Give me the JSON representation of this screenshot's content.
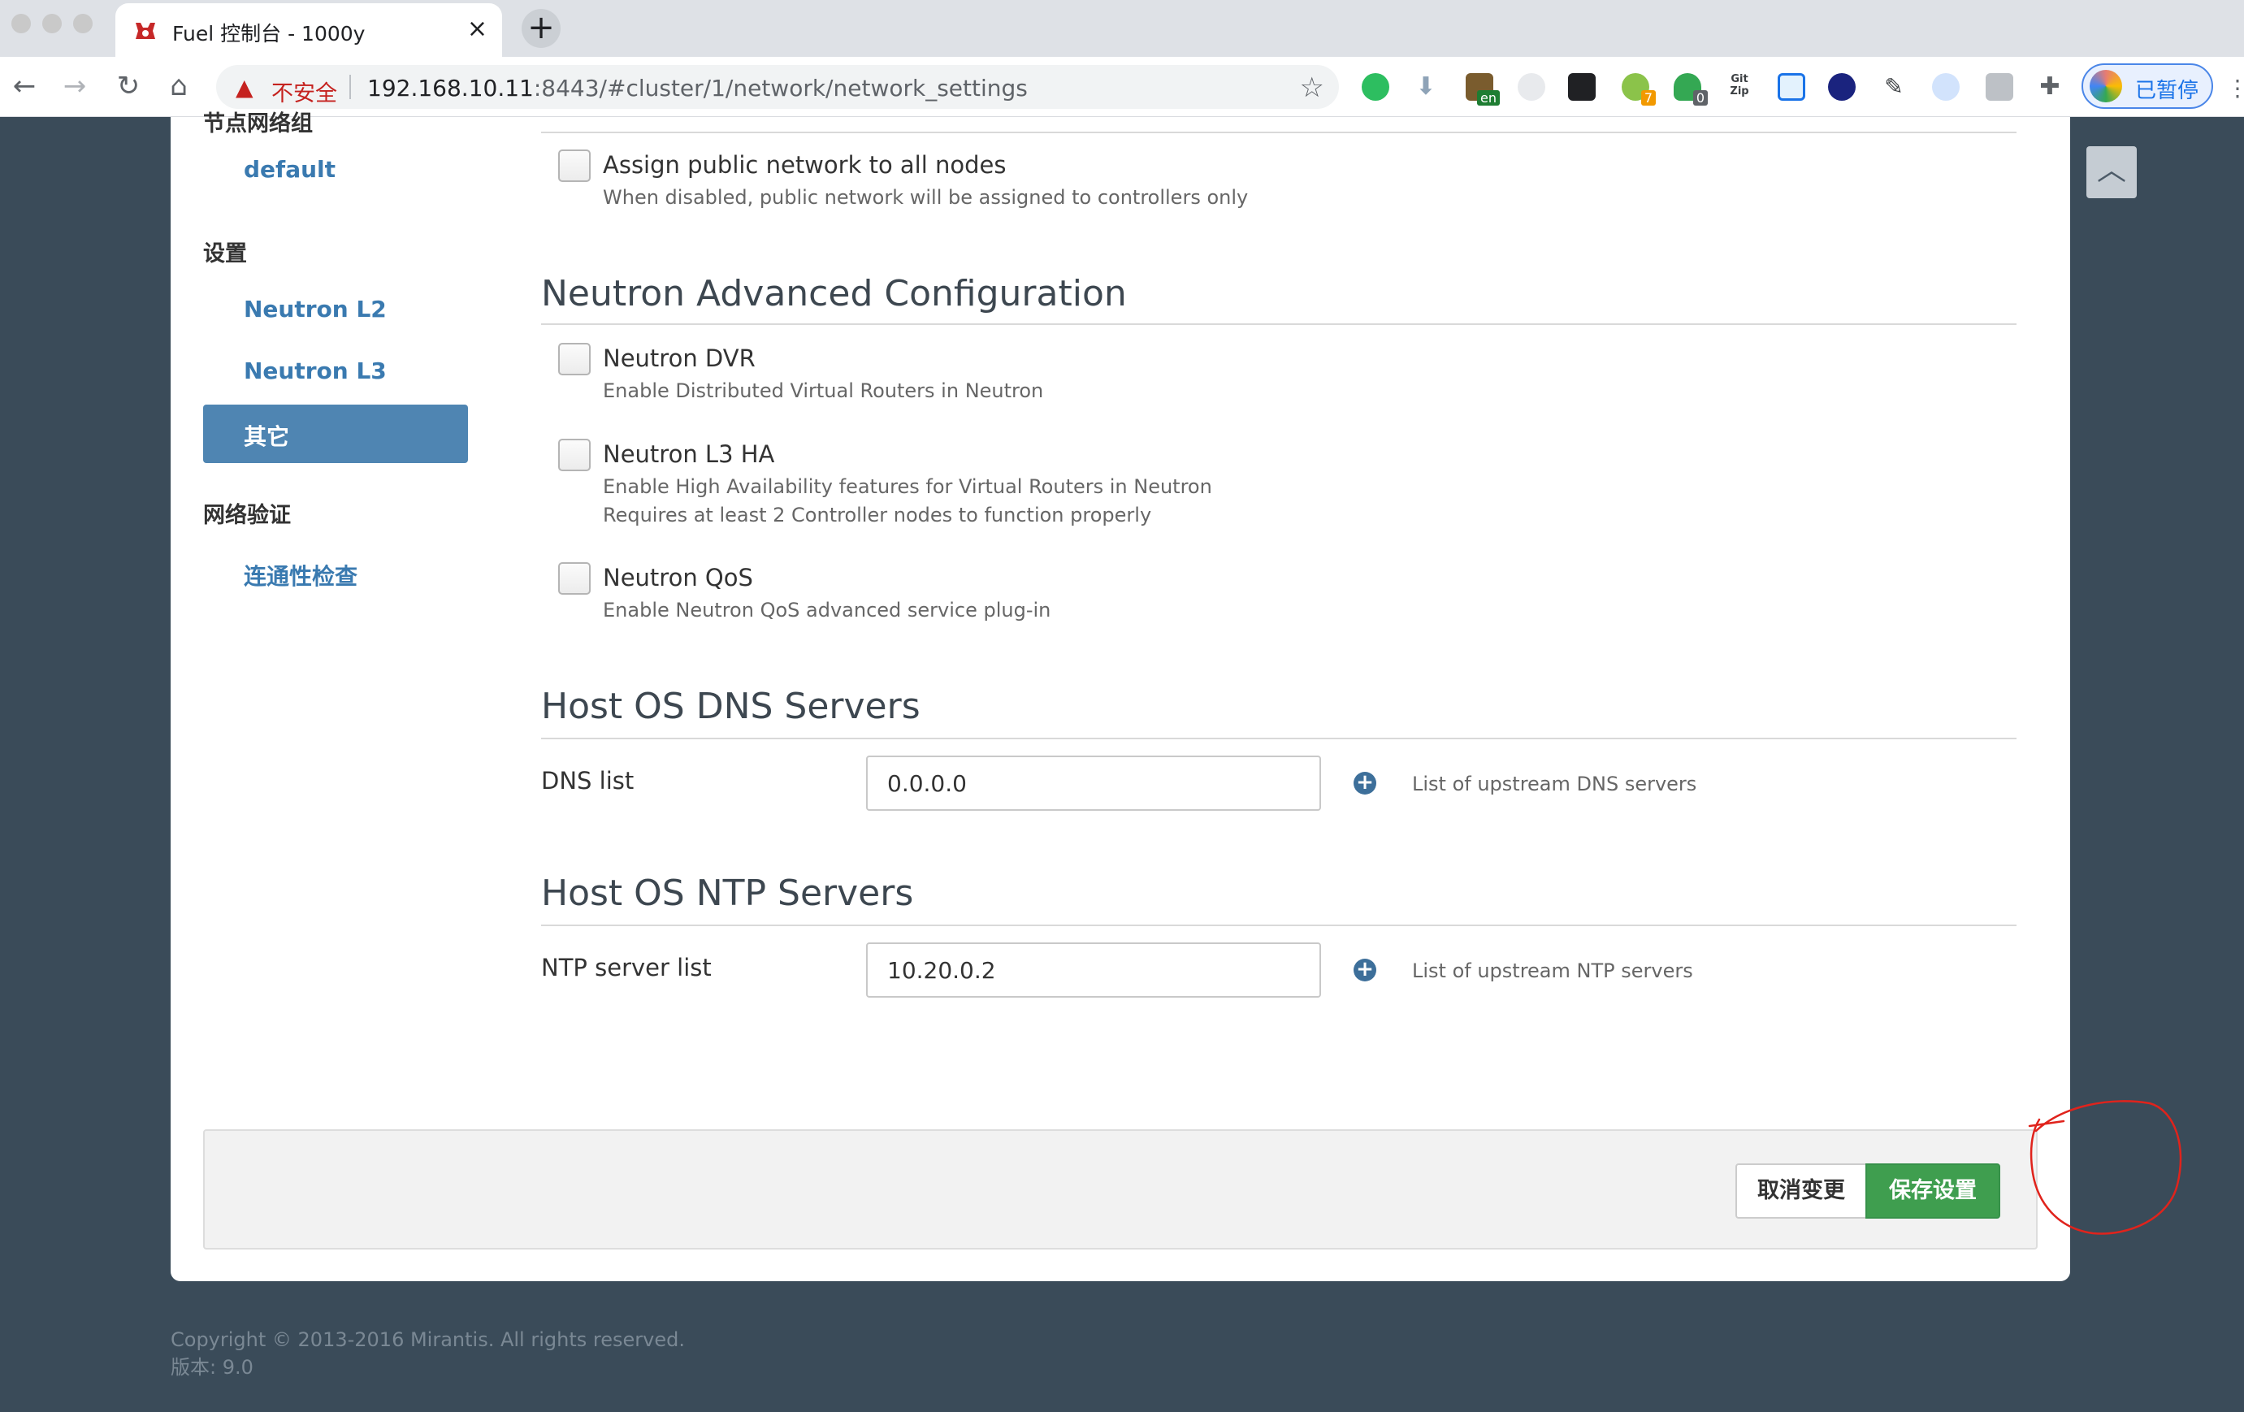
{
  "browser": {
    "tab_title": "Fuel 控制台 - 1000y",
    "tab_close": "×",
    "new_tab": "+",
    "security_label": "不安全",
    "url_host": "192.168.10.11",
    "url_rest": ":8443/#cluster/1/network/network_settings",
    "ext_badges": {
      "seven": "7",
      "zero": "0",
      "lang": "en",
      "gitzip": "Git Zip"
    },
    "profile_label": "已暂停"
  },
  "sidebar": {
    "clipped_heading": "节点网络组",
    "default_link": "default",
    "settings_heading": "设置",
    "items": [
      {
        "label": "Neutron L2"
      },
      {
        "label": "Neutron L3"
      },
      {
        "label": "其它"
      }
    ],
    "verify_heading": "网络验证",
    "verify_link": "连通性检查"
  },
  "public_network": {
    "label": "Assign public network to all nodes",
    "description": "When disabled, public network will be assigned to controllers only"
  },
  "neutron_advanced": {
    "title": "Neutron Advanced Configuration",
    "options": [
      {
        "label": "Neutron DVR",
        "description": [
          "Enable Distributed Virtual Routers in Neutron"
        ]
      },
      {
        "label": "Neutron L3 HA",
        "description": [
          "Enable High Availability features for Virtual Routers in Neutron",
          "Requires at least 2 Controller nodes to function properly"
        ]
      },
      {
        "label": "Neutron QoS",
        "description": [
          "Enable Neutron QoS advanced service plug-in"
        ]
      }
    ]
  },
  "dns": {
    "title": "Host OS DNS Servers",
    "label": "DNS list",
    "value": "0.0.0.0",
    "help": "List of upstream DNS servers"
  },
  "ntp": {
    "title": "Host OS NTP Servers",
    "label": "NTP server list",
    "value": "10.20.0.2",
    "help": "List of upstream NTP servers"
  },
  "footer": {
    "cancel_label": "取消变更",
    "save_label": "保存设置"
  },
  "copyright": {
    "line1": "Copyright © 2013-2016 Mirantis. All rights reserved.",
    "line2": "版本: 9.0"
  },
  "colors": {
    "page_background": "#3a4b59",
    "link": "#3a7ab0",
    "active_item": "#4f85b2",
    "save_button": "#3f9e4f",
    "annotation": "#e0231c"
  }
}
